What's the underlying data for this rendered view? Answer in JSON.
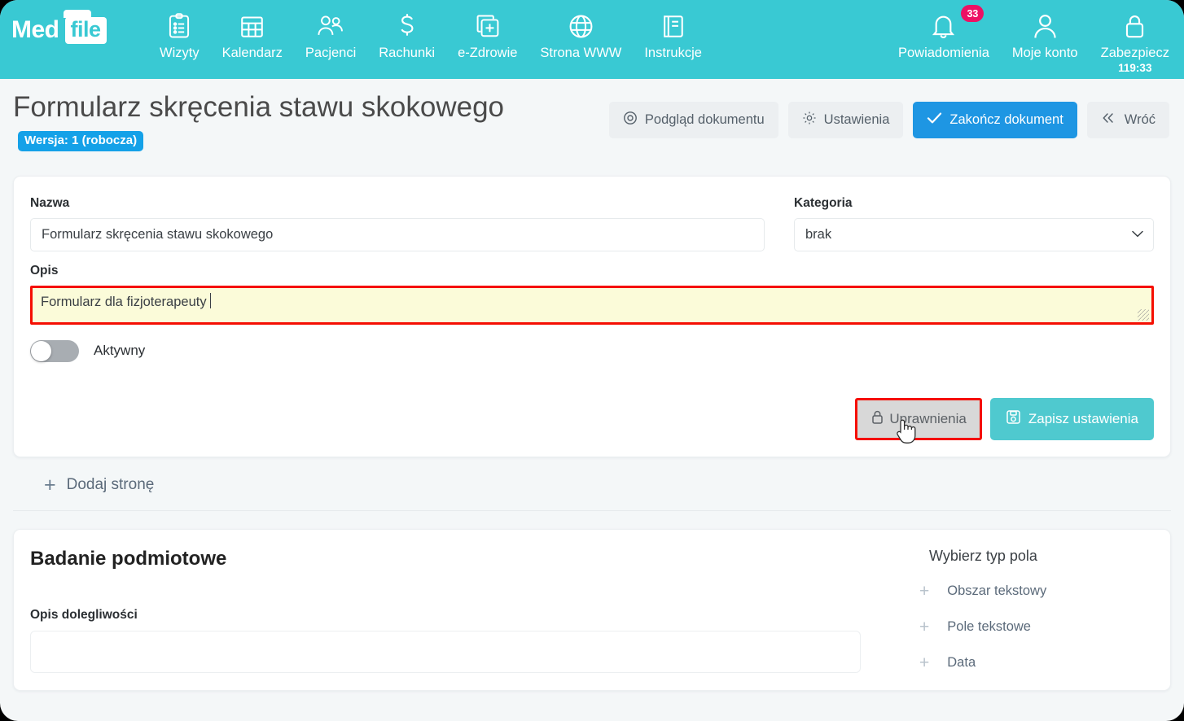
{
  "brand": {
    "part1": "Med",
    "part2": "file"
  },
  "nav": {
    "items": [
      {
        "label": "Wizyty",
        "icon": "clipboard-icon"
      },
      {
        "label": "Kalendarz",
        "icon": "calendar-icon"
      },
      {
        "label": "Pacjenci",
        "icon": "patients-icon"
      },
      {
        "label": "Rachunki",
        "icon": "dollar-icon"
      },
      {
        "label": "e-Zdrowie",
        "icon": "ehealth-icon"
      },
      {
        "label": "Strona WWW",
        "icon": "globe-icon"
      },
      {
        "label": "Instrukcje",
        "icon": "book-icon"
      }
    ],
    "right": {
      "notifications": {
        "label": "Powiadomienia",
        "badge": "33",
        "icon": "bell-icon"
      },
      "account": {
        "label": "Moje konto",
        "icon": "user-icon"
      },
      "secure": {
        "label": "Zabezpiecz",
        "timer": "119:33",
        "icon": "lock-icon"
      }
    },
    "accent_color": "#39c9d3",
    "badge_color": "#ed1164"
  },
  "header": {
    "title": "Formularz skręcenia stawu skokowego",
    "version_badge": "Wersja: 1 (robocza)",
    "actions": [
      {
        "label": "Podgląd dokumentu",
        "icon": "eye-icon",
        "style": "light"
      },
      {
        "label": "Ustawienia",
        "icon": "gear-icon",
        "style": "light"
      },
      {
        "label": "Zakończ dokument",
        "icon": "check-icon",
        "style": "blue"
      },
      {
        "label": "Wróć",
        "icon": "back-icon",
        "style": "light"
      }
    ],
    "blue_color": "#1e96e3"
  },
  "settings_card": {
    "name_label": "Nazwa",
    "name_value": "Formularz skręcenia stawu skokowego",
    "category_label": "Kategoria",
    "category_value": "brak",
    "category_options": [
      "brak"
    ],
    "description_label": "Opis",
    "description_value": "Formularz dla fizjoterapeuty",
    "active_label": "Aktywny",
    "active_state": "off",
    "permissions_button": "Uprawnienia",
    "save_button": "Zapisz ustawienia",
    "highlight_color": "#f50e02",
    "save_color": "#4fc9cf"
  },
  "add_page": {
    "label": "Dodaj stronę",
    "icon": "plus-icon"
  },
  "section": {
    "title": "Badanie podmiotowe",
    "field_label": "Opis dolegliwości",
    "field_value": "",
    "picker_title": "Wybierz typ pola",
    "picker_items": [
      {
        "label": "Obszar tekstowy"
      },
      {
        "label": "Pole tekstowe"
      },
      {
        "label": "Data"
      }
    ]
  }
}
